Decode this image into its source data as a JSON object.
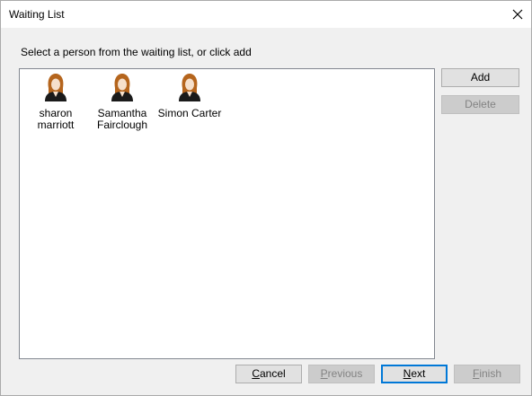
{
  "window": {
    "title": "Waiting List"
  },
  "instruction": "Select a person from the waiting list, or click add",
  "people": [
    {
      "name_line1": "sharon marriott",
      "name_line2": "",
      "icon": "person-avatar-icon"
    },
    {
      "name_line1": "Samantha",
      "name_line2": "Fairclough",
      "icon": "person-avatar-icon"
    },
    {
      "name_line1": "Simon Carter",
      "name_line2": "",
      "icon": "person-avatar-icon"
    }
  ],
  "side_buttons": {
    "add": "Add",
    "delete": "Delete"
  },
  "nav_buttons": {
    "cancel_mnemonic": "C",
    "cancel_rest": "ancel",
    "previous_mnemonic": "P",
    "previous_rest": "revious",
    "next_mnemonic": "N",
    "next_rest": "ext",
    "finish_mnemonic": "F",
    "finish_rest": "inish"
  },
  "colors": {
    "hair": "#b5651d",
    "skin": "#f6e0cc",
    "suit": "#1a1a1a"
  }
}
